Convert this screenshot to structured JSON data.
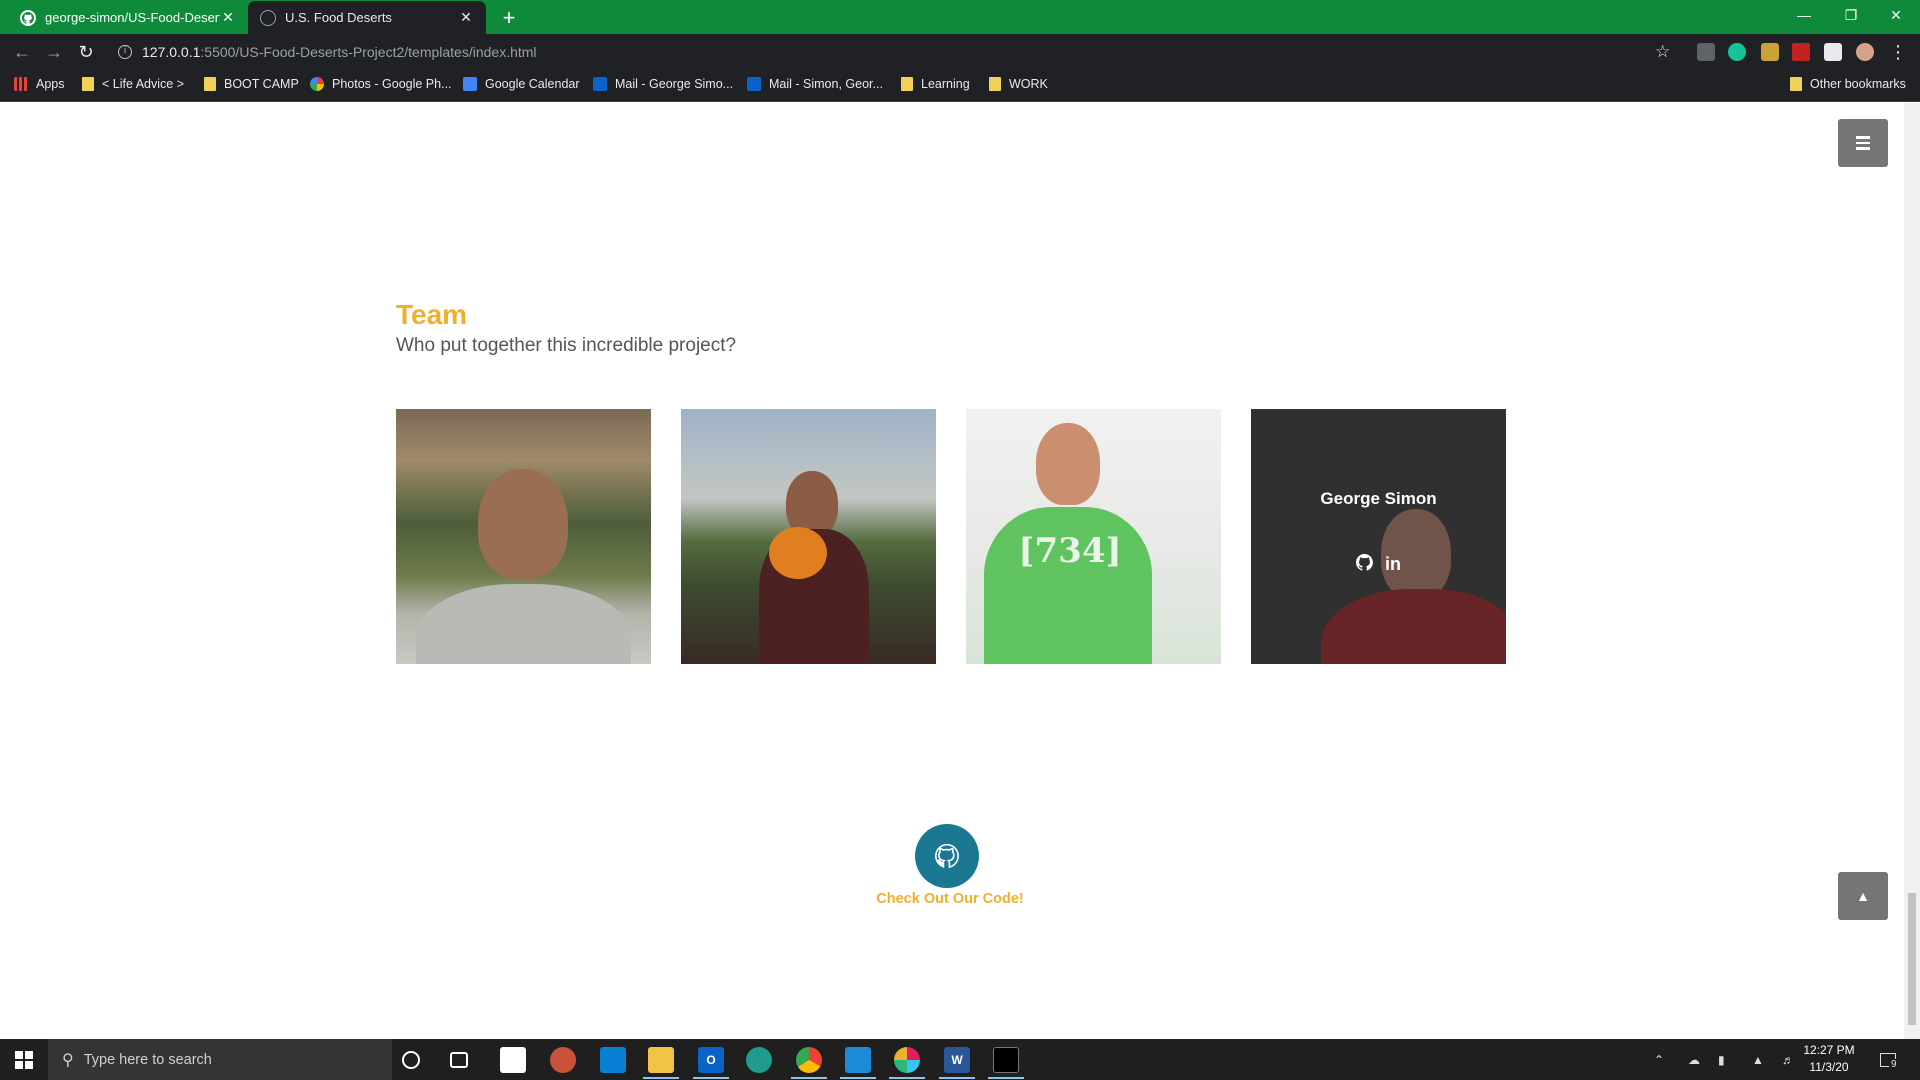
{
  "browser": {
    "tabs": [
      {
        "title": "george-simon/US-Food-Deserts",
        "active": false
      },
      {
        "title": "U.S. Food Deserts",
        "active": true
      }
    ],
    "new_tab": "+",
    "close_glyph": "✕",
    "url_host": "127.0.0.1",
    "url_path": ":5500/US-Food-Deserts-Project2/templates/index.html",
    "bookmarks": [
      {
        "label": "Apps"
      },
      {
        "label": "< Life Advice >"
      },
      {
        "label": "BOOT CAMP"
      },
      {
        "label": "Photos - Google Ph..."
      },
      {
        "label": "Google Calendar"
      },
      {
        "label": "Mail - George Simo..."
      },
      {
        "label": "Mail - Simon, Geor..."
      },
      {
        "label": "Learning"
      },
      {
        "label": "WORK"
      }
    ],
    "other_bookmarks": "Other bookmarks"
  },
  "page": {
    "section_title": "Team",
    "section_subtitle": "Who put together this incredible project?",
    "team": [
      {
        "name": "",
        "icon": "person-photo"
      },
      {
        "name": "",
        "icon": "person-photo"
      },
      {
        "name": "",
        "icon": "person-photo"
      },
      {
        "name": "George Simon",
        "github": "github-icon",
        "linkedin": "in"
      }
    ],
    "shirt_text": "[734]",
    "code_link": "Check Out Our Code!",
    "colors": {
      "accent": "#f0b02b",
      "button": "#1a7893",
      "tabbar": "#0e8a3a"
    }
  },
  "taskbar": {
    "search_placeholder": "Type here to search",
    "time": "12:27 PM",
    "date": "11/3/20",
    "notifications": "9"
  }
}
